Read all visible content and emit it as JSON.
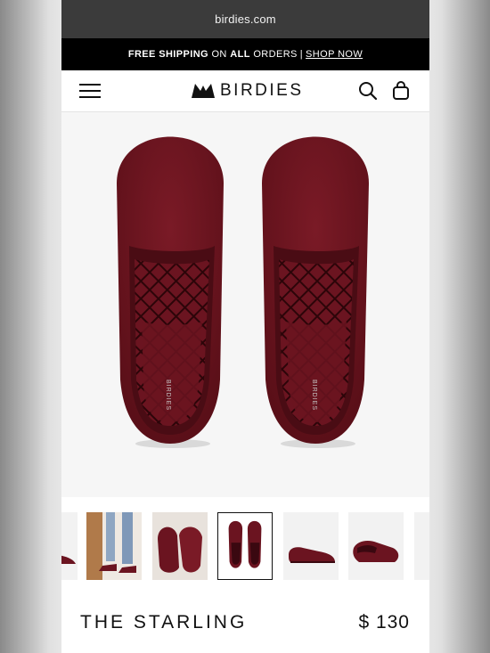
{
  "browser": {
    "url": "birdies.com"
  },
  "promo": {
    "bold_lead": "FREE SHIPPING",
    "middle": "ON",
    "bold_all": "ALL",
    "tail": "ORDERS",
    "separator": "|",
    "link": "SHOP NOW"
  },
  "header": {
    "logo": "BIRDIES"
  },
  "hero": {
    "insole_brand": "BIRDIES"
  },
  "gallery": {
    "thumbnails": [
      {
        "name": "partial-shoe"
      },
      {
        "name": "model-wearing"
      },
      {
        "name": "pair-angled"
      },
      {
        "name": "pair-top-view",
        "selected": true
      },
      {
        "name": "side-profile"
      },
      {
        "name": "three-quarter"
      },
      {
        "name": "partial-next"
      }
    ]
  },
  "product": {
    "name": "THE STARLING",
    "price": "$ 130"
  },
  "colors": {
    "shoe": "#6b1420",
    "shoe_dark": "#4a0c14",
    "quilting": "#2c0509"
  }
}
